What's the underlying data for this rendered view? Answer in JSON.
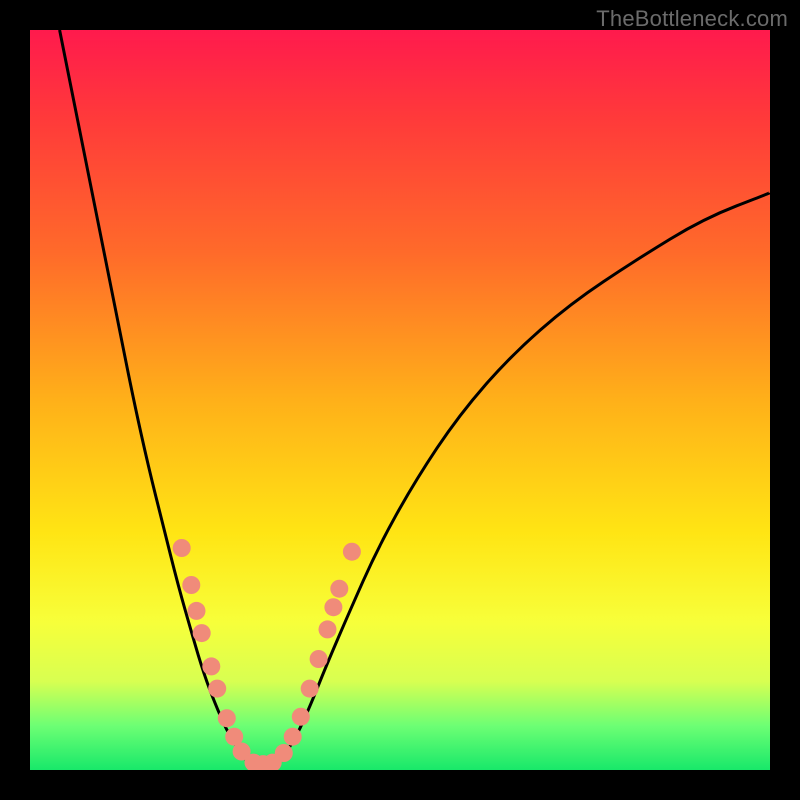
{
  "watermark": "TheBottleneck.com",
  "chart_data": {
    "type": "line",
    "title": "",
    "xlabel": "",
    "ylabel": "",
    "xlim": [
      0,
      100
    ],
    "ylim": [
      0,
      100
    ],
    "series": [
      {
        "name": "curve-left",
        "x": [
          4,
          6,
          8,
          10,
          12,
          14,
          16,
          18,
          20,
          22,
          23.5,
          25,
          26.5,
          28,
          29
        ],
        "y": [
          100,
          90,
          80,
          70,
          60,
          50,
          41,
          33,
          25,
          18,
          13,
          9,
          5.5,
          3,
          1.5
        ]
      },
      {
        "name": "curve-bottom",
        "x": [
          29,
          30,
          31,
          32,
          33,
          34
        ],
        "y": [
          1.5,
          0.8,
          0.5,
          0.5,
          0.8,
          1.5
        ]
      },
      {
        "name": "curve-right",
        "x": [
          34,
          36,
          38,
          40,
          43,
          47,
          52,
          58,
          65,
          73,
          82,
          91,
          100
        ],
        "y": [
          1.5,
          4.5,
          9,
          14,
          21,
          30,
          39,
          48,
          56,
          63,
          69,
          74.5,
          78
        ]
      }
    ],
    "markers": [
      {
        "x": 20.5,
        "y": 30
      },
      {
        "x": 21.8,
        "y": 25
      },
      {
        "x": 22.5,
        "y": 21.5
      },
      {
        "x": 23.2,
        "y": 18.5
      },
      {
        "x": 24.5,
        "y": 14
      },
      {
        "x": 25.3,
        "y": 11
      },
      {
        "x": 26.6,
        "y": 7
      },
      {
        "x": 27.6,
        "y": 4.5
      },
      {
        "x": 28.6,
        "y": 2.5
      },
      {
        "x": 30.2,
        "y": 1.0
      },
      {
        "x": 31.5,
        "y": 0.8
      },
      {
        "x": 32.8,
        "y": 1.0
      },
      {
        "x": 34.3,
        "y": 2.3
      },
      {
        "x": 35.5,
        "y": 4.5
      },
      {
        "x": 36.6,
        "y": 7.2
      },
      {
        "x": 37.8,
        "y": 11
      },
      {
        "x": 39.0,
        "y": 15
      },
      {
        "x": 40.2,
        "y": 19
      },
      {
        "x": 41.0,
        "y": 22
      },
      {
        "x": 41.8,
        "y": 24.5
      },
      {
        "x": 43.5,
        "y": 29.5
      }
    ],
    "colors": {
      "curve": "#000000",
      "marker": "#f08b7a",
      "gradient_top": "#ff1a4d",
      "gradient_mid": "#ffe514",
      "gradient_bottom": "#18e86a"
    }
  }
}
